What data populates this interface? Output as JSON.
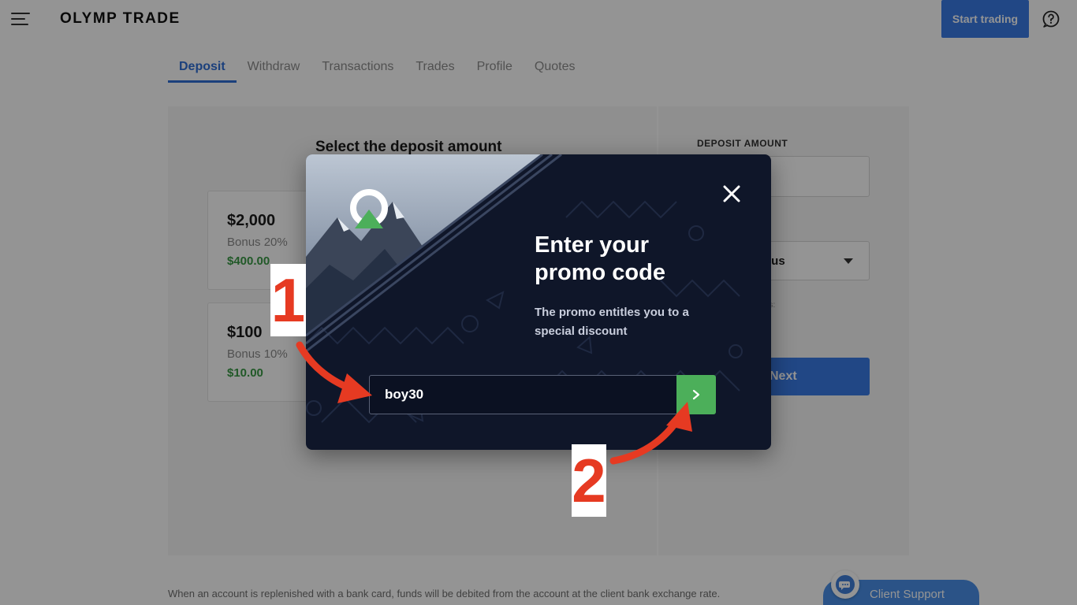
{
  "header": {
    "logo_text": "OLYMP TRADE",
    "start_trading_label": "Start trading",
    "menu_icon": "hamburger-menu-icon",
    "help_icon": "question-bubble-icon"
  },
  "tabs": [
    {
      "label": "Deposit",
      "active": true
    },
    {
      "label": "Withdraw",
      "active": false
    },
    {
      "label": "Transactions",
      "active": false
    },
    {
      "label": "Trades",
      "active": false
    },
    {
      "label": "Profile",
      "active": false
    },
    {
      "label": "Quotes",
      "active": false
    }
  ],
  "deposit": {
    "select_title": "Select the deposit amount",
    "cards": [
      {
        "amount": "$2,000",
        "bonus": "Bonus 20%",
        "bonus_value": "$400.00"
      },
      {
        "amount": "$100",
        "bonus": "Bonus 10%",
        "bonus_value": "$10.00"
      }
    ],
    "amount_label": "DEPOSIT AMOUNT",
    "bonus_select_visible": "nus",
    "bonus_note_visible": "us:",
    "next_visible": "Next"
  },
  "footer_note": "When an account is replenished with a bank card, funds will be debited from the account at the client bank exchange rate.",
  "support": {
    "label": "Client Support",
    "icon": "chat-bubble-icon"
  },
  "modal": {
    "title_line1": "Enter your",
    "title_line2": "promo code",
    "subtitle": "The promo entitles you to a special discount",
    "promo_value": "boy30",
    "close_icon": "close-icon",
    "submit_icon": "chevron-right-icon"
  },
  "annotations": {
    "step1": "1",
    "step2": "2"
  },
  "colors": {
    "brand_blue": "#3a7be6",
    "bonus_green": "#3a9a45",
    "modal_bg": "#0f1629",
    "submit_green": "#4caf5a",
    "annotation_red": "#e63a22"
  }
}
